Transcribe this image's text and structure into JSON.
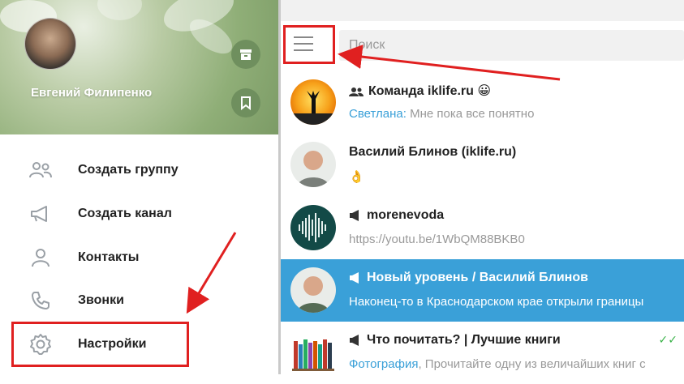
{
  "profile": {
    "name": "Евгений Филипенко"
  },
  "menu": {
    "items": [
      {
        "label": "Создать группу",
        "icon": "group-icon"
      },
      {
        "label": "Создать канал",
        "icon": "megaphone-icon"
      },
      {
        "label": "Контакты",
        "icon": "person-icon"
      },
      {
        "label": "Звонки",
        "icon": "phone-icon"
      },
      {
        "label": "Настройки",
        "icon": "gear-icon"
      }
    ]
  },
  "search": {
    "placeholder": "Поиск"
  },
  "chats": [
    {
      "title": "Команда iklife.ru 😀",
      "kind": "group",
      "sender": "Светлана:",
      "preview": " Мне пока все понятно"
    },
    {
      "title": "Василий Блинов (iklife.ru)",
      "kind": "person",
      "sender": "",
      "preview": "👌"
    },
    {
      "title": "morenevoda",
      "kind": "channel",
      "sender": "",
      "preview": "https://youtu.be/1WbQM88BKB0"
    },
    {
      "title": "Новый уровень / Василий Блинов",
      "kind": "channel",
      "sender": "",
      "preview": "Наконец-то в Краснодарском крае открыли границы"
    },
    {
      "title": "Что почитать? | Лучшие книги",
      "kind": "channel",
      "sender": "Фотография",
      "preview": ", Прочитайте одну из величайших книг с"
    }
  ],
  "colors": {
    "accent": "#3aa0d8",
    "annotation": "#e02020",
    "read_check": "#3bb34a"
  }
}
